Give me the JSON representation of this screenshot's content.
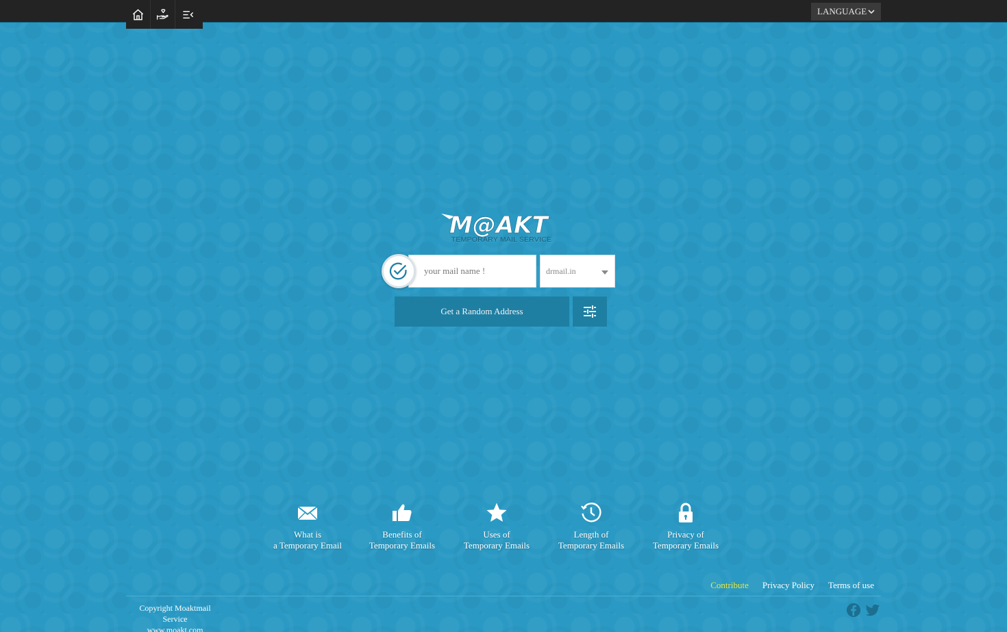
{
  "header": {
    "nav": [
      {
        "name": "home-icon"
      },
      {
        "name": "donate-icon"
      },
      {
        "name": "menu-collapse-icon"
      }
    ],
    "language_label": "LANGUAGE"
  },
  "brand": {
    "logo_text": "M@AKT",
    "subtitle": "TEMPORARY MAIL SERVICE"
  },
  "form": {
    "mail_placeholder": "your mail name !",
    "domain_selected": "drmail.in",
    "random_button_label": "Get a Random Address"
  },
  "features": [
    {
      "icon": "envelope-icon",
      "line1": "What is",
      "line2": "a Temporary Email"
    },
    {
      "icon": "thumbs-up-icon",
      "line1": "Benefits of",
      "line2": "Temporary Emails"
    },
    {
      "icon": "star-icon",
      "line1": "Uses of",
      "line2": "Temporary Emails"
    },
    {
      "icon": "history-clock-icon",
      "line1": "Length of",
      "line2": "Temporary Emails"
    },
    {
      "icon": "lock-icon",
      "line1": "Privacy of",
      "line2": "Temporary Emails"
    }
  ],
  "footer": {
    "links": [
      "Contribute",
      "Privacy Policy",
      "Terms of use"
    ],
    "copyright_line1": "Copyright Moaktmail Service",
    "copyright_line2": "www.moakt.com"
  },
  "colors": {
    "background": "#2a9ac4",
    "topbar": "#232323",
    "button": "#1e7fa3",
    "contribute_link": "#e9ea3d"
  }
}
